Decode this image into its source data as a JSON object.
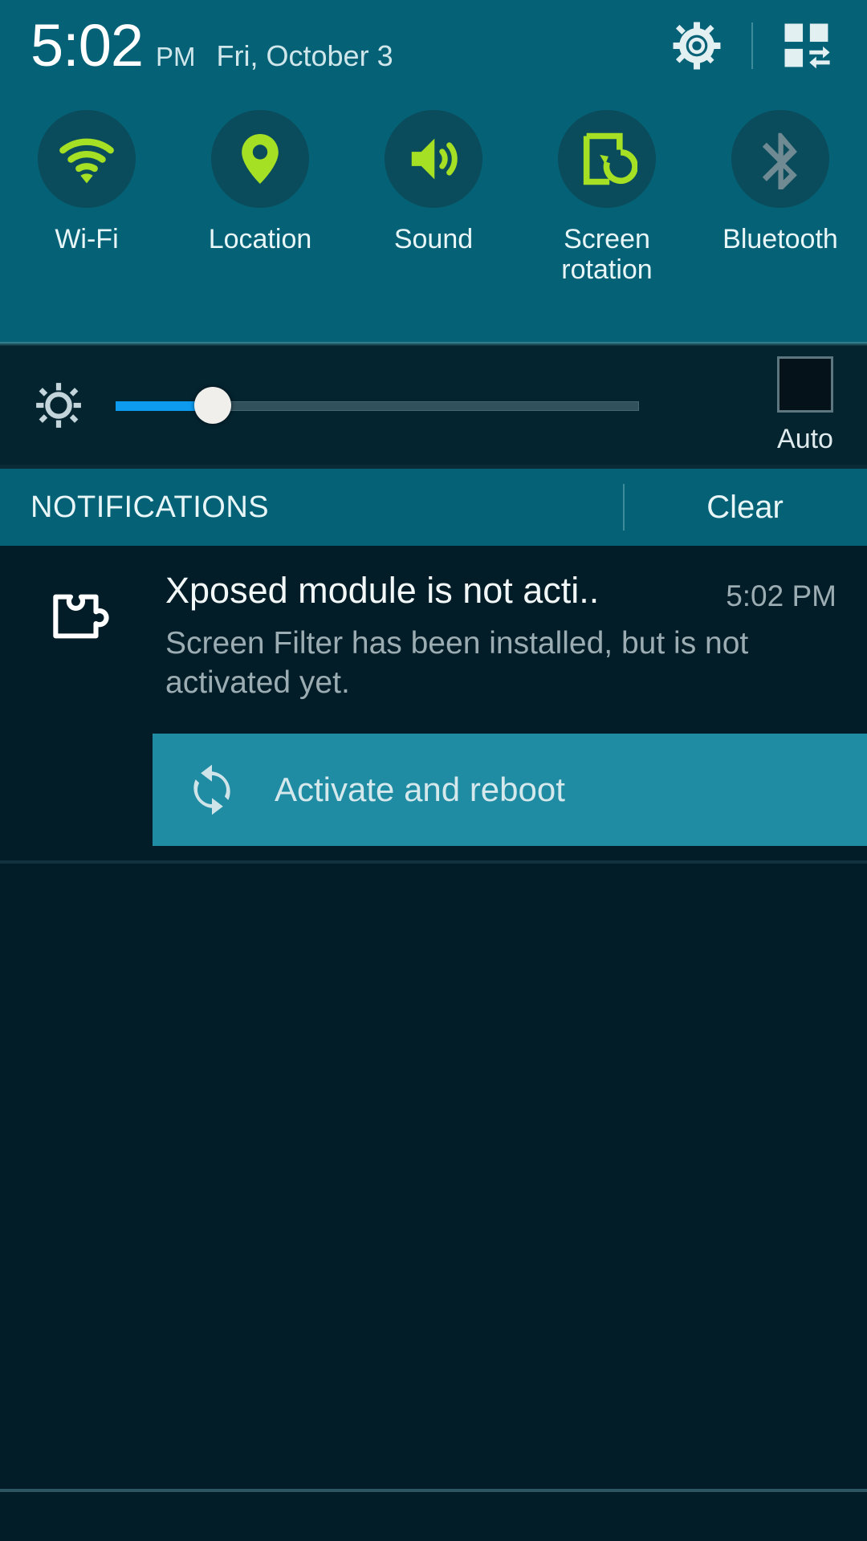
{
  "statusbar": {
    "time": "5:02",
    "ampm": "PM",
    "date": "Fri, October 3",
    "settings_icon": "gear-icon",
    "edit_quick_settings_icon": "grid-swap-icon"
  },
  "quick_toggles": [
    {
      "label": "Wi-Fi",
      "icon": "wifi-icon",
      "state": "on"
    },
    {
      "label": "Location",
      "icon": "location-pin-icon",
      "state": "on"
    },
    {
      "label": "Sound",
      "icon": "sound-speaker-icon",
      "state": "on"
    },
    {
      "label": "Screen\nrotation",
      "label_line1": "Screen",
      "label_line2": "rotation",
      "icon": "screen-rotation-icon",
      "state": "on"
    },
    {
      "label": "Bluetooth",
      "icon": "bluetooth-icon",
      "state": "off"
    }
  ],
  "brightness": {
    "icon": "brightness-gear-icon",
    "value_percent": 18,
    "auto_label": "Auto",
    "auto_checked": false,
    "fill_color": "#0d9bf0"
  },
  "notifications_header": {
    "title": "NOTIFICATIONS",
    "clear_label": "Clear"
  },
  "notification": {
    "icon": "xposed-puzzle-icon",
    "title": "Xposed module is not acti..",
    "time": "5:02 PM",
    "text": "Screen Filter has been installed, but is not activated yet.",
    "action": {
      "icon": "sync-refresh-icon",
      "label": "Activate and reboot",
      "background": "#1f8ca3"
    }
  },
  "colors": {
    "header_teal": "#056175",
    "toggle_circle": "#0a4c5b",
    "accent_green": "#a6e024",
    "disabled_grey": "#6f8a92",
    "panel_dark": "#021d27",
    "brightness_bg": "#042430"
  }
}
